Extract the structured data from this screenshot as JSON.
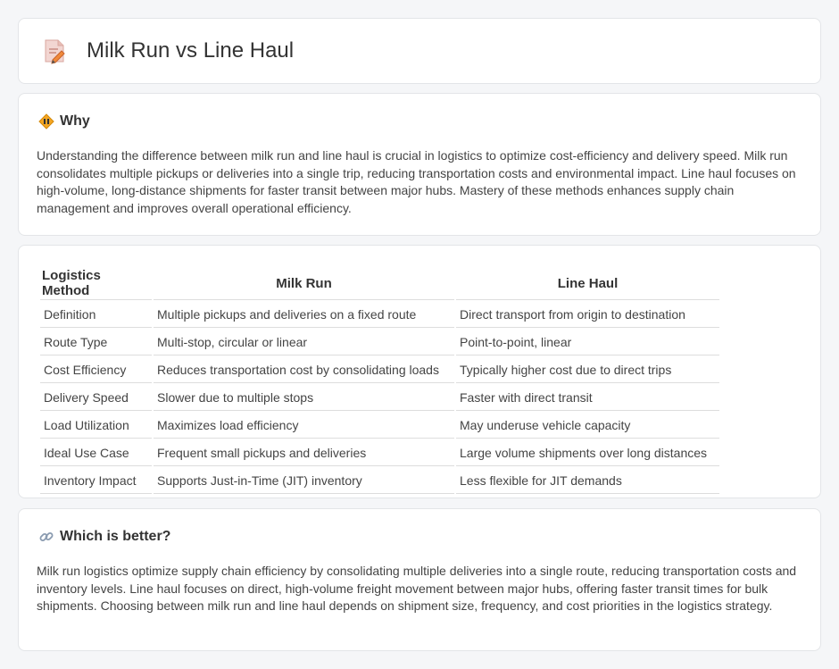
{
  "header": {
    "title": "Milk Run vs Line Haul",
    "icon": "document-pencil-icon"
  },
  "why": {
    "heading": "Why",
    "icon": "diamond-sign-icon",
    "text": "Understanding the difference between milk run and line haul is crucial in logistics to optimize cost-efficiency and delivery speed. Milk run consolidates multiple pickups or deliveries into a single trip, reducing transportation costs and environmental impact. Line haul focuses on high-volume, long-distance shipments for faster transit between major hubs. Mastery of these methods enhances supply chain management and improves overall operational efficiency."
  },
  "comparison": {
    "headers": [
      "Logistics Method",
      "Milk Run",
      "Line Haul"
    ],
    "rows": [
      [
        "Definition",
        "Multiple pickups and deliveries on a fixed route",
        "Direct transport from origin to destination"
      ],
      [
        "Route Type",
        "Multi-stop, circular or linear",
        "Point-to-point, linear"
      ],
      [
        "Cost Efficiency",
        "Reduces transportation cost by consolidating loads",
        "Typically higher cost due to direct trips"
      ],
      [
        "Delivery Speed",
        "Slower due to multiple stops",
        "Faster with direct transit"
      ],
      [
        "Load Utilization",
        "Maximizes load efficiency",
        "May underuse vehicle capacity"
      ],
      [
        "Ideal Use Case",
        "Frequent small pickups and deliveries",
        "Large volume shipments over long distances"
      ],
      [
        "Inventory Impact",
        "Supports Just-in-Time (JIT) inventory",
        "Less flexible for JIT demands"
      ]
    ]
  },
  "better": {
    "heading": "Which is better?",
    "icon": "link-icon",
    "text": "Milk run logistics optimize supply chain efficiency by consolidating multiple deliveries into a single route, reducing transportation costs and inventory levels. Line haul focuses on direct, high-volume freight movement between major hubs, offering faster transit times for bulk shipments. Choosing between milk run and line haul depends on shipment size, frequency, and cost priorities in the logistics strategy."
  }
}
